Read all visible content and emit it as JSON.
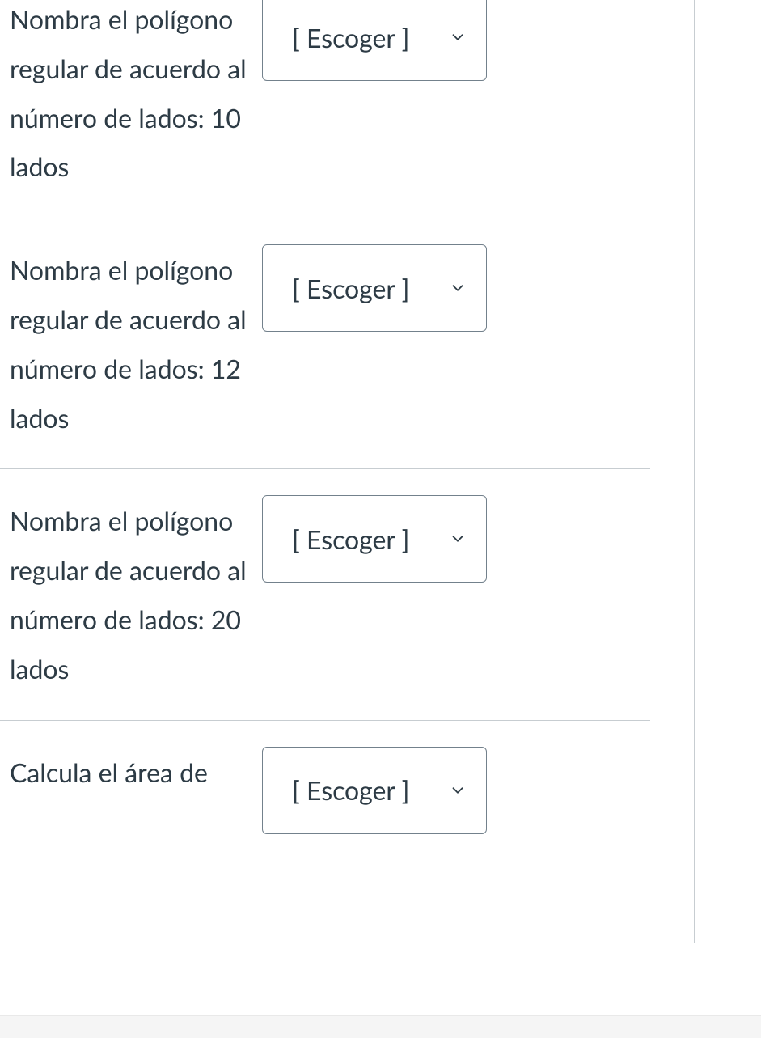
{
  "dropdown_placeholder": "[ Escoger ]",
  "questions": [
    {
      "prompt": "Nombra el polígono regular de acuerdo al número de lados: 10 lados",
      "selected": "[ Escoger ]"
    },
    {
      "prompt": "Nombra el polígono regular de acuerdo al número de lados: 12 lados",
      "selected": "[ Escoger ]"
    },
    {
      "prompt": "Nombra el polígono regular de acuerdo al número de lados: 20 lados",
      "selected": "[ Escoger ]"
    },
    {
      "prompt": "Calcula el área de",
      "selected": "[ Escoger ]"
    }
  ]
}
